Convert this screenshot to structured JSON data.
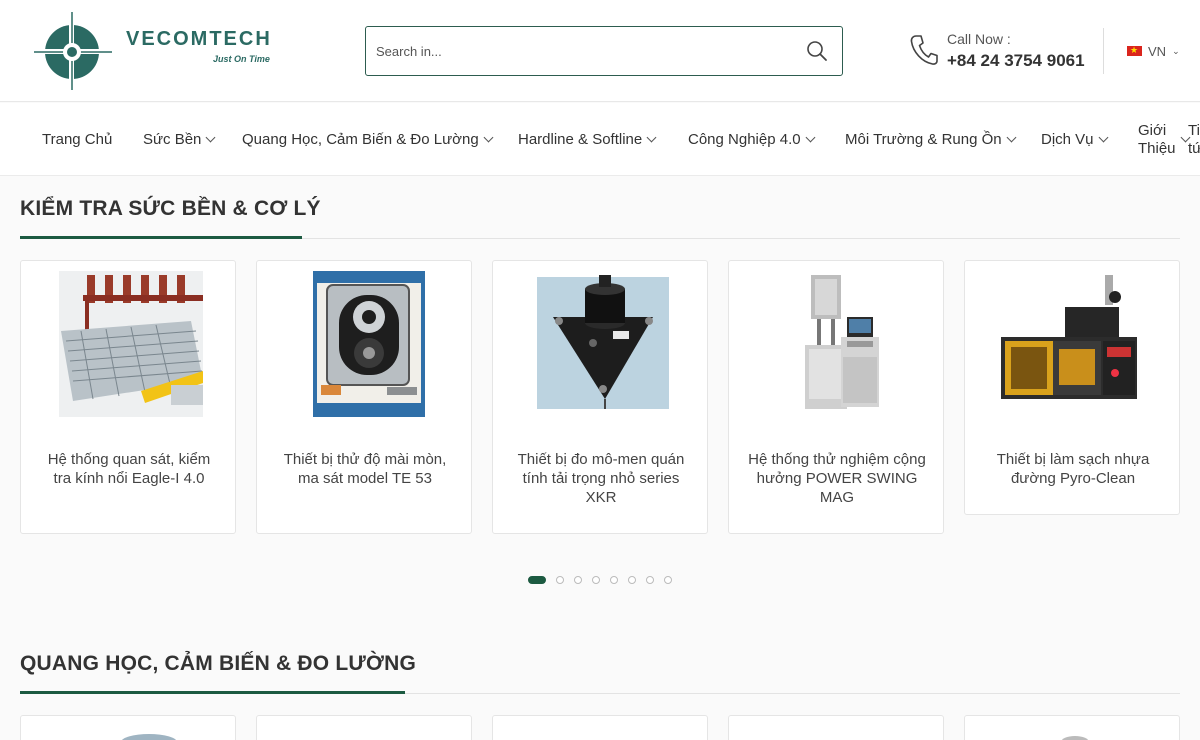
{
  "header": {
    "logo": {
      "name": "VECOMTECH",
      "slogan": "Just On Time",
      "color": "#2b6a63"
    },
    "search": {
      "placeholder": "Search in...",
      "value": "",
      "icon": "search-icon"
    },
    "call": {
      "label": "Call Now :",
      "number": "+84 24 3754 9061",
      "icon": "phone-icon"
    },
    "language": {
      "label": "VN",
      "flag": "vietnam-flag"
    }
  },
  "nav": {
    "items": [
      {
        "label": "Trang Chủ",
        "has_dropdown": false
      },
      {
        "label": "Sức Bền",
        "has_dropdown": true
      },
      {
        "label": "Quang Học, Cảm Biến & Đo Lường",
        "has_dropdown": true
      },
      {
        "label": "Hardline & Softline",
        "has_dropdown": true
      },
      {
        "label": "Công Nghiệp 4.0",
        "has_dropdown": true
      },
      {
        "label": "Môi Trường & Rung Ồn",
        "has_dropdown": true
      },
      {
        "label": "Dịch Vụ",
        "has_dropdown": true
      },
      {
        "label": "Giới Thiệu",
        "has_dropdown": true
      },
      {
        "label": "Ti tứ",
        "has_dropdown": false
      }
    ]
  },
  "sections": [
    {
      "title": "KIỂM TRA SỨC BỀN & CƠ LÝ",
      "products": [
        {
          "title": "Hệ thống quan sát, kiểm tra kính nổi Eagle-I 4.0",
          "image": "glass-inspection-system"
        },
        {
          "title": "Thiết bị thử độ mài mòn, ma sát model TE 53",
          "image": "abrasion-tester"
        },
        {
          "title": "Thiết bị đo mô-men quán tính tải trọng nhỏ series XKR",
          "image": "moment-of-inertia-instrument"
        },
        {
          "title": "Hệ thống thử nghiệm cộng hưởng POWER SWING MAG",
          "image": "resonance-test-system"
        },
        {
          "title": "Thiết bị làm sạch nhựa đường Pyro-Clean",
          "image": "asphalt-cleaning-oven"
        }
      ],
      "carousel": {
        "pages": 9,
        "active": 0
      }
    },
    {
      "title": "QUANG HỌC, CẢM BIẾN & ĐO LƯỜNG"
    }
  ],
  "colors": {
    "accent": "#1c5a41",
    "brand": "#2b6a63"
  }
}
